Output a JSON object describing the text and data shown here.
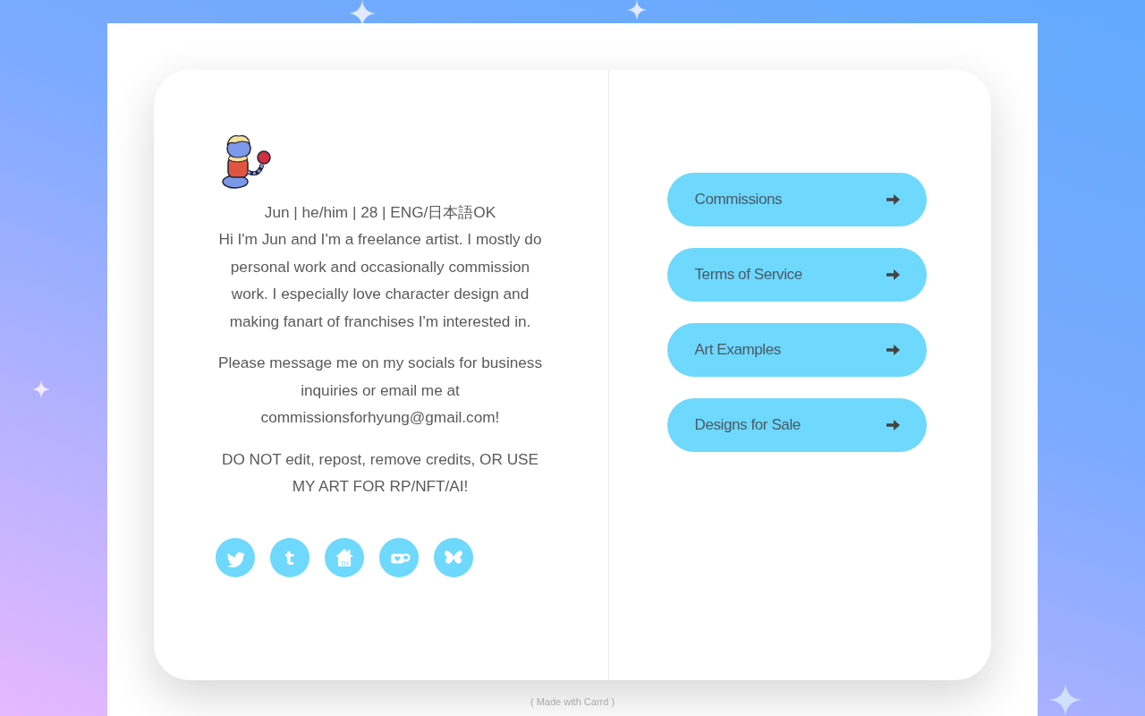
{
  "profile": {
    "tagline": "Jun | he/him | 28 | ENG/日本語OK",
    "paragraphs": [
      "Hi I'm Jun and I'm a freelance artist. I mostly do personal work and occasionally commission work. I especially love character design and making fanart of franchises I'm interested in.",
      "Please message me on my socials for business inquiries or email me at commissionsforhyung@gmail.com!",
      "DO NOT edit, repost, remove credits, OR USE MY ART FOR RP/NFT/AI!"
    ]
  },
  "socials": [
    {
      "kind": "bird"
    },
    {
      "kind": "letter",
      "glyph": "t"
    },
    {
      "kind": "house",
      "glyph": "TH"
    },
    {
      "kind": "cup"
    },
    {
      "kind": "butterfly"
    }
  ],
  "links": [
    {
      "label": "Commissions"
    },
    {
      "label": "Terms of Service"
    },
    {
      "label": "Art Examples"
    },
    {
      "label": "Designs for Sale"
    }
  ],
  "footer": "( Made with Carrd )"
}
